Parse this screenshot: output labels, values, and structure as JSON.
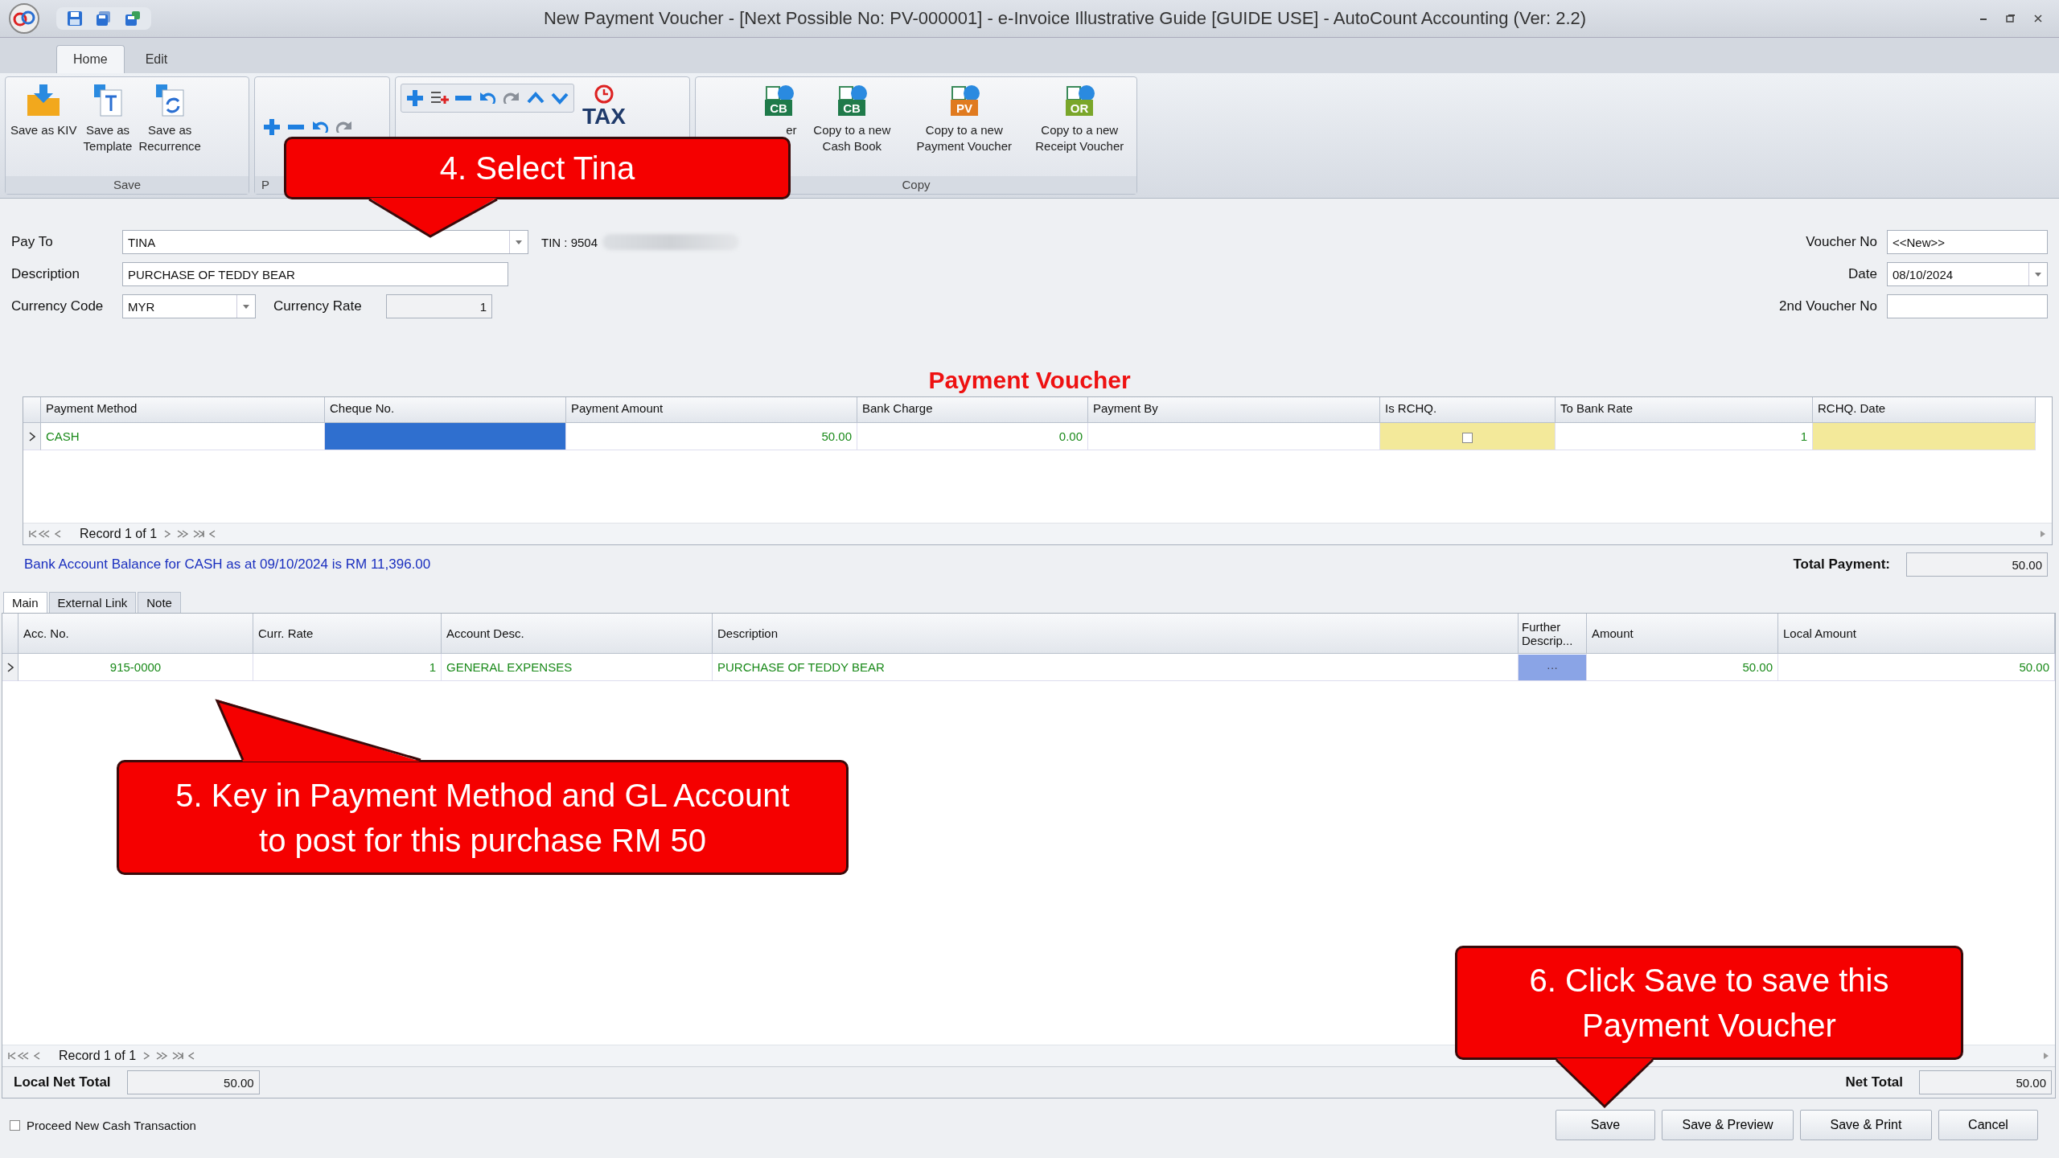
{
  "window": {
    "title": "New Payment Voucher - [Next Possible No: PV-000001] - e-Invoice Illustrative Guide [GUIDE USE] - AutoCount Accounting (Ver: 2.2)"
  },
  "ribbon": {
    "tabs": [
      {
        "label": "Home",
        "selected": true
      },
      {
        "label": "Edit",
        "selected": false
      }
    ],
    "save_group": {
      "label": "Save",
      "buttons": [
        {
          "label": "Save as KIV",
          "kind": "kiv"
        },
        {
          "label": "Save as\nTemplate",
          "kind": "template"
        },
        {
          "label": "Save as\nRecurrence",
          "kind": "recurrence"
        }
      ]
    },
    "second_group": {
      "label": "P"
    },
    "third_group": {
      "tax_label": "TAX"
    },
    "copy_group": {
      "label": "Copy",
      "buttons": [
        {
          "label": "er",
          "badge": "CB"
        },
        {
          "label": "Copy to a new\nCash Book",
          "badge": "CB"
        },
        {
          "label": "Copy to a new\nPayment Voucher",
          "badge": "PV"
        },
        {
          "label": "Copy to a new\nReceipt Voucher",
          "badge": "OR"
        }
      ]
    }
  },
  "form": {
    "pay_to": {
      "label": "Pay To",
      "value": "TINA"
    },
    "tin": "TIN : 9504",
    "description": {
      "label": "Description",
      "value": "PURCHASE OF TEDDY BEAR"
    },
    "currency_code": {
      "label": "Currency Code",
      "value": "MYR"
    },
    "currency_rate": {
      "label": "Currency Rate",
      "value": "1"
    },
    "voucher_no": {
      "label": "Voucher No",
      "value": "<<New>>"
    },
    "date": {
      "label": "Date",
      "value": "08/10/2024"
    },
    "second_voucher_no": {
      "label": "2nd Voucher No"
    }
  },
  "payment_table": {
    "title": "Payment Voucher",
    "columns": [
      {
        "label": "Payment Method",
        "highlighted": false
      },
      {
        "label": "Cheque No.",
        "highlighted": false
      },
      {
        "label": "Payment Amount",
        "highlighted": false
      },
      {
        "label": "Bank Charge",
        "highlighted": false
      },
      {
        "label": "Payment By",
        "highlighted": false
      },
      {
        "label": "Is RCHQ.",
        "highlighted": true
      },
      {
        "label": "To Bank Rate",
        "highlighted": false
      },
      {
        "label": "RCHQ. Date",
        "highlighted": true
      }
    ],
    "rows": [
      {
        "selected": true,
        "cells": [
          {
            "kind": "text",
            "value": "CASH",
            "focused": false
          },
          {
            "kind": "text",
            "focused": true
          },
          {
            "kind": "text",
            "value": "50.00",
            "focused": false
          },
          {
            "kind": "text",
            "value": "0.00",
            "focused": false
          },
          {
            "kind": "text",
            "focused": false
          },
          {
            "kind": "checkbox",
            "checked": false,
            "focused": false
          },
          {
            "kind": "text",
            "value": "1",
            "focused": false
          },
          {
            "kind": "text",
            "focused": false
          }
        ]
      }
    ],
    "navigator": "Record 1 of 1"
  },
  "bank_balance": "Bank Account Balance for CASH as at 09/10/2024 is RM 11,396.00",
  "total_payment": {
    "label": "Total Payment:",
    "value": "50.00"
  },
  "detail_tabs": [
    {
      "label": "Main",
      "selected": true
    },
    {
      "label": "External Link",
      "selected": false
    },
    {
      "label": "Note",
      "selected": false
    }
  ],
  "detail_table": {
    "columns": [
      "Acc. No.",
      "Curr. Rate",
      "Account Desc.",
      "Description",
      "Further Descrip...",
      "Amount",
      "Local Amount"
    ],
    "rows": [
      {
        "selected": true,
        "cells": [
          {
            "kind": "text",
            "value": "915-0000"
          },
          {
            "kind": "text",
            "value": "1"
          },
          {
            "kind": "text",
            "value": "GENERAL EXPENSES"
          },
          {
            "kind": "text",
            "value": "PURCHASE OF TEDDY BEAR"
          },
          {
            "kind": "button",
            "value": "···"
          },
          {
            "kind": "text",
            "value": "50.00"
          },
          {
            "kind": "text",
            "value": "50.00"
          }
        ]
      }
    ],
    "navigator": "Record 1 of 1"
  },
  "totals": {
    "local_net_total": {
      "label": "Local Net Total",
      "value": "50.00"
    },
    "net_total": {
      "label": "Net Total",
      "value": "50.00"
    }
  },
  "proceed_checkbox": {
    "label": "Proceed New Cash Transaction",
    "checked": false
  },
  "buttons": [
    "Save",
    "Save & Preview",
    "Save & Print",
    "Cancel"
  ],
  "callouts": [
    {
      "text": "4. Select Tina"
    },
    {
      "text": "5. Key in Payment Method and GL Account\nto post for this purchase RM 50"
    },
    {
      "text": "6. Click Save to save this\nPayment Voucher"
    }
  ]
}
